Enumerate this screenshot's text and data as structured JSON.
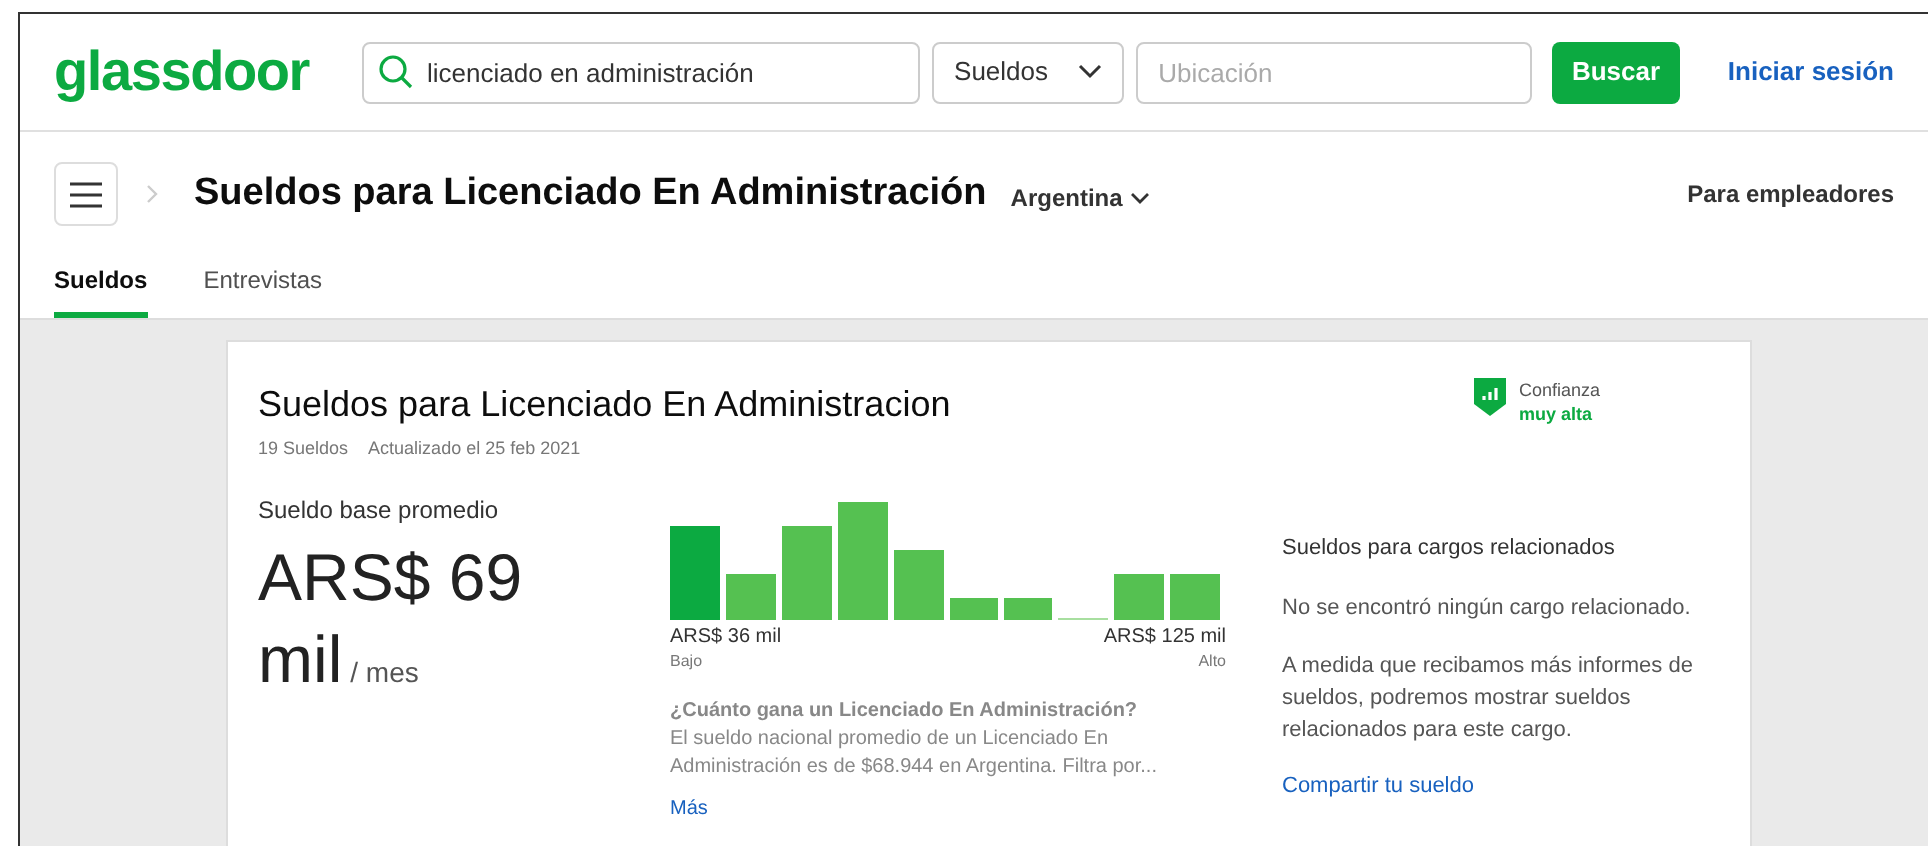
{
  "header": {
    "logo": "glassdoor",
    "search": {
      "value": "licenciado en administración"
    },
    "category": {
      "value": "Sueldos"
    },
    "location": {
      "placeholder": "Ubicación"
    },
    "search_button": "Buscar",
    "sign_in": "Iniciar sesión"
  },
  "subheader": {
    "title": "Sueldos para Licenciado En Administración",
    "country": "Argentina",
    "employers": "Para empleadores"
  },
  "tabs": [
    {
      "label": "Sueldos",
      "selected": true
    },
    {
      "label": "Entrevistas",
      "selected": false
    }
  ],
  "card": {
    "title": "Sueldos para Licenciado En Administracion",
    "count": "19 Sueldos",
    "updated": "Actualizado el 25 feb 2021",
    "confidence": {
      "label": "Confianza",
      "value": "muy alta"
    },
    "base_label": "Sueldo base promedio",
    "amount": "ARS$ 69 mil",
    "period": "/ mes",
    "low": {
      "value": "ARS$ 36 mil",
      "label": "Bajo"
    },
    "high": {
      "value": "ARS$ 125 mil",
      "label": "Alto"
    },
    "question": "¿Cuánto gana un Licenciado En Administración?",
    "answer": "El sueldo nacional promedio de un Licenciado En Administración es de $68.944 en Argentina. Filtra por...",
    "more": "Más",
    "related": {
      "title": "Sueldos para cargos relacionados",
      "none": "No se encontró ningún cargo relacionado.",
      "note": "A medida que recibamos más informes de sueldos, podremos mostrar sueldos relacionados para este cargo.",
      "link": "Compartir tu sueldo"
    }
  }
}
